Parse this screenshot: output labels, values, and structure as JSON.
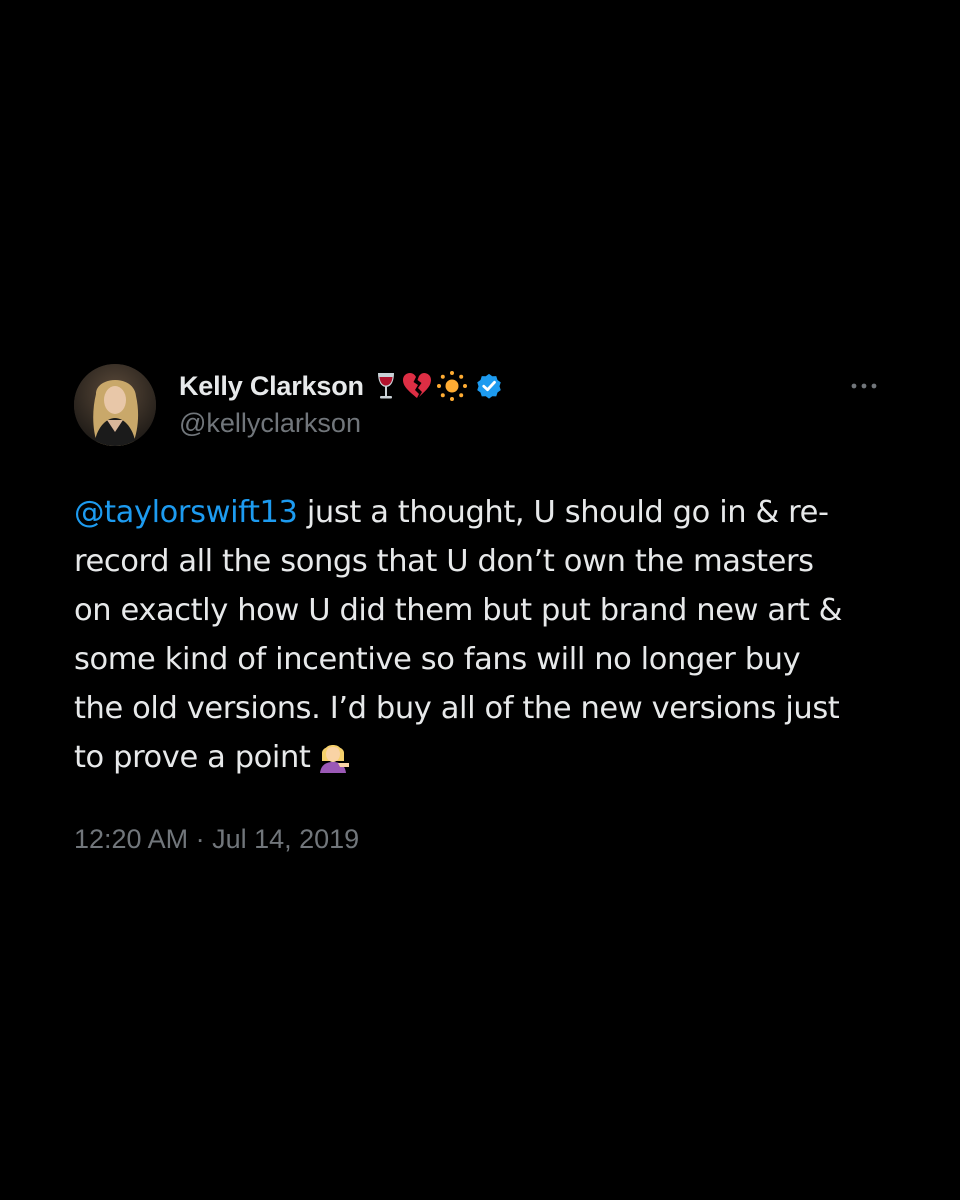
{
  "author": {
    "display_name": "Kelly Clarkson",
    "handle": "@kellyclarkson",
    "name_emojis": [
      "wine-glass-icon",
      "broken-heart-icon",
      "sun-icon"
    ],
    "verified": true,
    "avatar": "avatar"
  },
  "tweet": {
    "mention": "@taylorswift13",
    "lines": [
      " just a thought, U should go in & re-",
      "record all the songs that U don’t own the masters",
      "on exactly how U did them but put brand new art &",
      "some kind of incentive so fans will no longer buy",
      "the old versions. I’d buy all of the new versions just",
      "to prove a point"
    ],
    "trailing_emoji": "person-tipping-hand-icon",
    "timestamp": "12:20 AM · Jul 14, 2019"
  },
  "colors": {
    "background": "#000000",
    "text": "#e7e9ea",
    "secondary": "#71767b",
    "link": "#1d9bf0",
    "verified": "#1d9bf0"
  },
  "icons": {
    "more": "more-options-icon"
  }
}
